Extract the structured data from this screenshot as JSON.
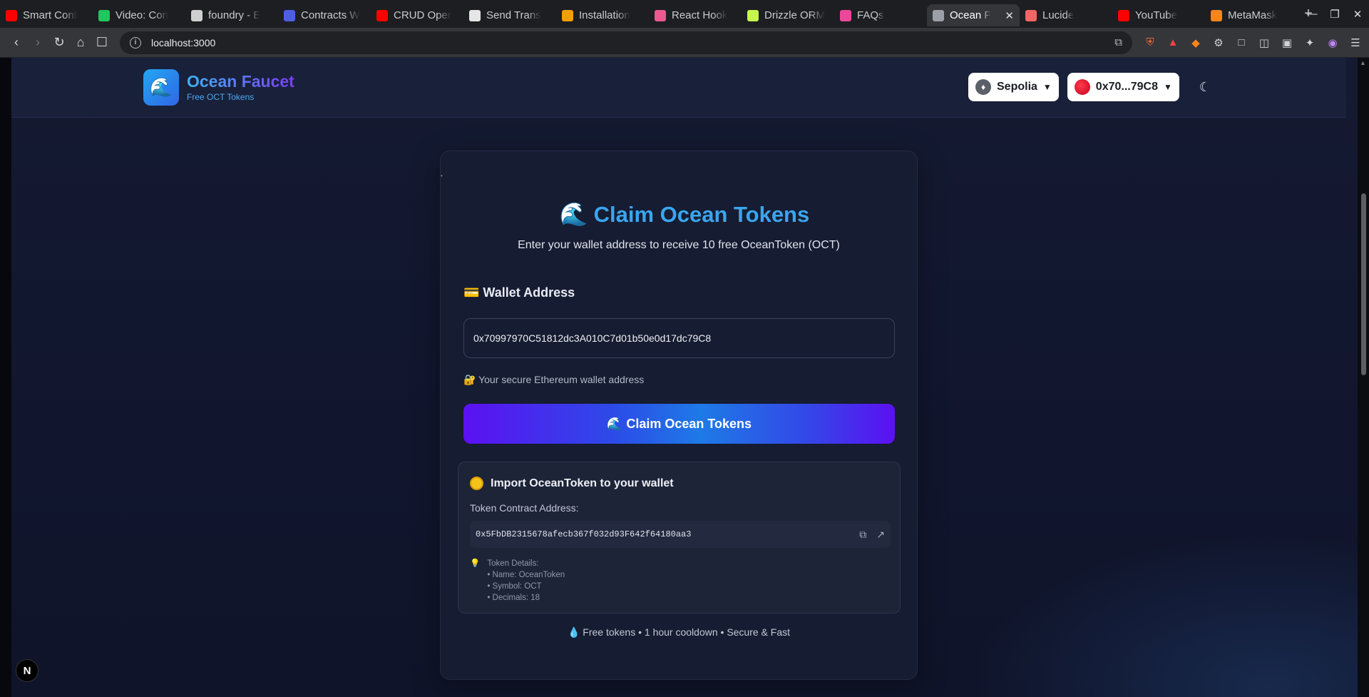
{
  "browser": {
    "tabs": [
      {
        "label": "Smart Cont",
        "icon": "youtube-icon",
        "color": "#ff0000",
        "active": false
      },
      {
        "label": "Video: Con",
        "icon": "video-icon",
        "color": "#22c55e",
        "active": false
      },
      {
        "label": "foundry - E",
        "icon": "foundry-icon",
        "color": "#cfcfcf",
        "active": false
      },
      {
        "label": "Contracts W",
        "icon": "zeppelin-icon",
        "color": "#4e5ee4",
        "active": false
      },
      {
        "label": "CRUD Oper",
        "icon": "youtube-icon",
        "color": "#ff0000",
        "active": false
      },
      {
        "label": "Send Trans",
        "icon": "wagmi-icon",
        "color": "#e6e6e6",
        "active": false
      },
      {
        "label": "Installation",
        "icon": "rainbow-icon",
        "color": "#f59e0b",
        "active": false
      },
      {
        "label": "React Hook",
        "icon": "react-hook-form-icon",
        "color": "#ec5990",
        "active": false
      },
      {
        "label": "Drizzle ORM",
        "icon": "drizzle-icon",
        "color": "#c5f74f",
        "active": false
      },
      {
        "label": "FAQs",
        "icon": "gear-icon",
        "color": "#ec4899",
        "active": false
      },
      {
        "label": "Ocean F",
        "icon": "globe-icon",
        "color": "#9aa0a6",
        "active": true
      },
      {
        "label": "Lucide",
        "icon": "lucide-icon",
        "color": "#f56565",
        "active": false
      },
      {
        "label": "YouTube",
        "icon": "youtube-icon",
        "color": "#ff0000",
        "active": false
      },
      {
        "label": "MetaMask",
        "icon": "metamask-icon",
        "color": "#f6851b",
        "active": false
      }
    ],
    "new_tab": "+",
    "url": "localhost:3000"
  },
  "site": {
    "brand_title": "Ocean Faucet",
    "brand_subtitle": "Free OCT Tokens",
    "network": "Sepolia",
    "account": "0x70...79C8"
  },
  "claim": {
    "title": "Claim Ocean Tokens",
    "subtitle": "Enter your wallet address to receive 10 free OceanToken (OCT)",
    "wallet_label": "💳 Wallet Address",
    "wallet_value": "0x70997970C51812dc3A010C7d01b50e0d17dc79C8",
    "wallet_hint": "🔐 Your secure Ethereum wallet address",
    "button_label": "🌊 Claim Ocean Tokens"
  },
  "import": {
    "title": "Import OceanToken to your wallet",
    "contract_label": "Token Contract Address:",
    "contract_address": "0x5FbDB2315678afecb367f032d93F642f64180aa3",
    "details_heading": "Token Details:",
    "details": [
      "• Name: OceanToken",
      "• Symbol: OCT",
      "• Decimals: 18"
    ]
  },
  "footer": "💧 Free tokens • 1 hour cooldown • Secure & Fast",
  "nextjs_badge": "N"
}
